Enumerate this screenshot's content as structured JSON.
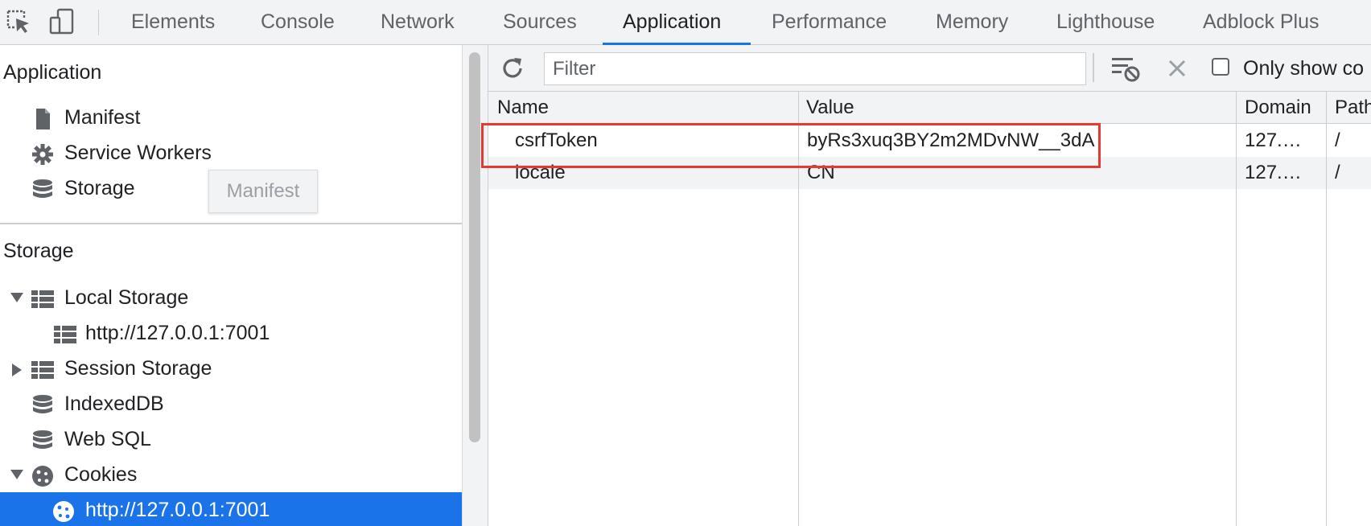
{
  "toolbar": {
    "inspect_icon": "inspect-element-icon",
    "device_icon": "device-toolbar-icon",
    "tabs": [
      {
        "label": "Elements"
      },
      {
        "label": "Console"
      },
      {
        "label": "Network"
      },
      {
        "label": "Sources"
      },
      {
        "label": "Application"
      },
      {
        "label": "Performance"
      },
      {
        "label": "Memory"
      },
      {
        "label": "Lighthouse"
      },
      {
        "label": "Adblock Plus"
      }
    ],
    "active_tab": "Application",
    "accent_color": "#1a73e8"
  },
  "sidebar": {
    "application_header": "Application",
    "application_items": [
      {
        "label": "Manifest",
        "icon": "document-icon"
      },
      {
        "label": "Service Workers",
        "icon": "gear-icon"
      },
      {
        "label": "Storage",
        "icon": "database-icon"
      }
    ],
    "tooltip": "Manifest",
    "storage_header": "Storage",
    "storage_items": [
      {
        "label": "Local Storage",
        "icon": "grid-icon",
        "expanded": true
      },
      {
        "label": "http://127.0.0.1:7001",
        "icon": "grid-icon"
      },
      {
        "label": "Session Storage",
        "icon": "grid-icon",
        "expanded": false
      },
      {
        "label": "IndexedDB",
        "icon": "database-icon"
      },
      {
        "label": "Web SQL",
        "icon": "database-icon"
      },
      {
        "label": "Cookies",
        "icon": "cookie-icon",
        "expanded": true
      },
      {
        "label": "http://127.0.0.1:7001",
        "icon": "cookie-icon",
        "selected": true
      }
    ],
    "selected_color": "#1a73e8"
  },
  "cookies_panel": {
    "filter_placeholder": "Filter",
    "filter_value": "",
    "only_show_label": "Only show co",
    "columns": [
      "Name",
      "Value",
      "Domain",
      "Path"
    ],
    "rows": [
      {
        "name": "csrfToken",
        "value": "byRs3xuq3BY2m2MDvNW__3dA",
        "domain": "127.…",
        "path": "/"
      },
      {
        "name": "locale",
        "value": "CN",
        "domain": "127.…",
        "path": "/"
      }
    ],
    "highlight_color": "#e53935"
  }
}
